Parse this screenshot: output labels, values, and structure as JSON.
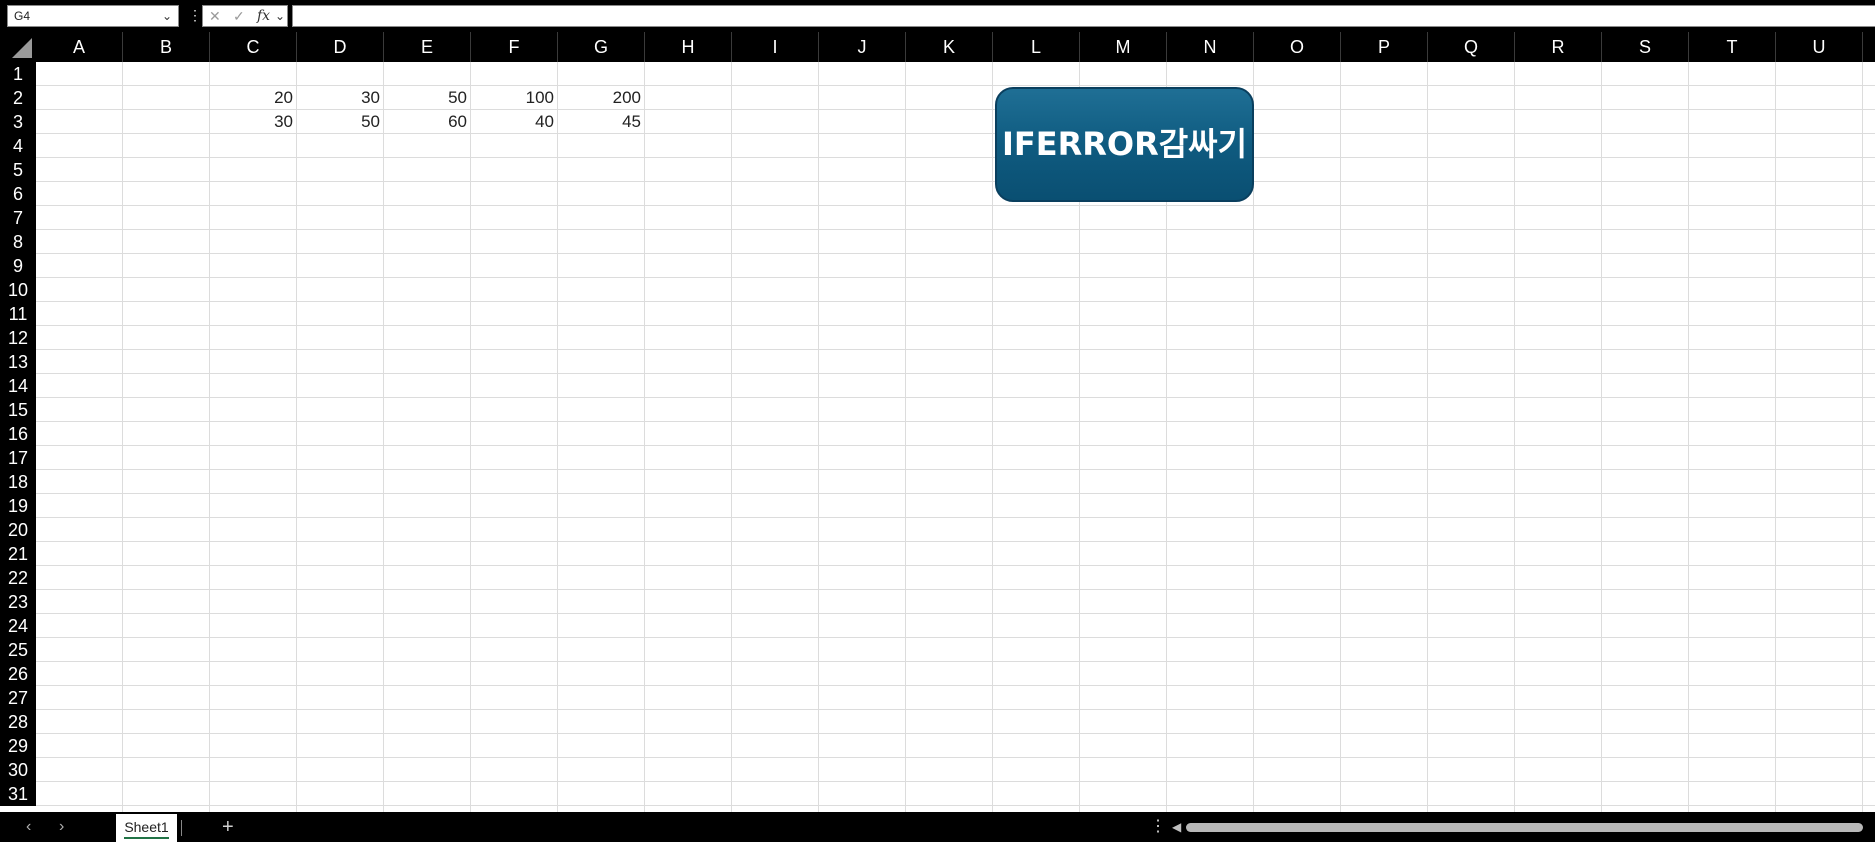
{
  "formula_bar": {
    "name_box": "G4",
    "formula": ""
  },
  "columns": [
    "A",
    "B",
    "C",
    "D",
    "E",
    "F",
    "G",
    "H",
    "I",
    "J",
    "K",
    "L",
    "M",
    "N",
    "O",
    "P",
    "Q",
    "R",
    "S",
    "T",
    "U"
  ],
  "rows": [
    "1",
    "2",
    "3",
    "4",
    "5",
    "6",
    "7",
    "8",
    "9",
    "10",
    "11",
    "12",
    "13",
    "14",
    "15",
    "16",
    "17",
    "18",
    "19",
    "20",
    "21",
    "22",
    "23",
    "24",
    "25",
    "26",
    "27",
    "28",
    "29",
    "30",
    "31"
  ],
  "cells": {
    "row2": {
      "C": "20",
      "D": "30",
      "E": "50",
      "F": "100",
      "G": "200"
    },
    "row3": {
      "C": "30",
      "D": "50",
      "E": "60",
      "F": "40",
      "G": "45"
    }
  },
  "shape_button": {
    "label": "IFERROR감싸기"
  },
  "sheets": [
    {
      "name": "Sheet1",
      "active": true
    }
  ],
  "colors": {
    "shape_fill": "#0f5b80",
    "active_tab_underline": "#217346",
    "chrome": "#000000"
  }
}
